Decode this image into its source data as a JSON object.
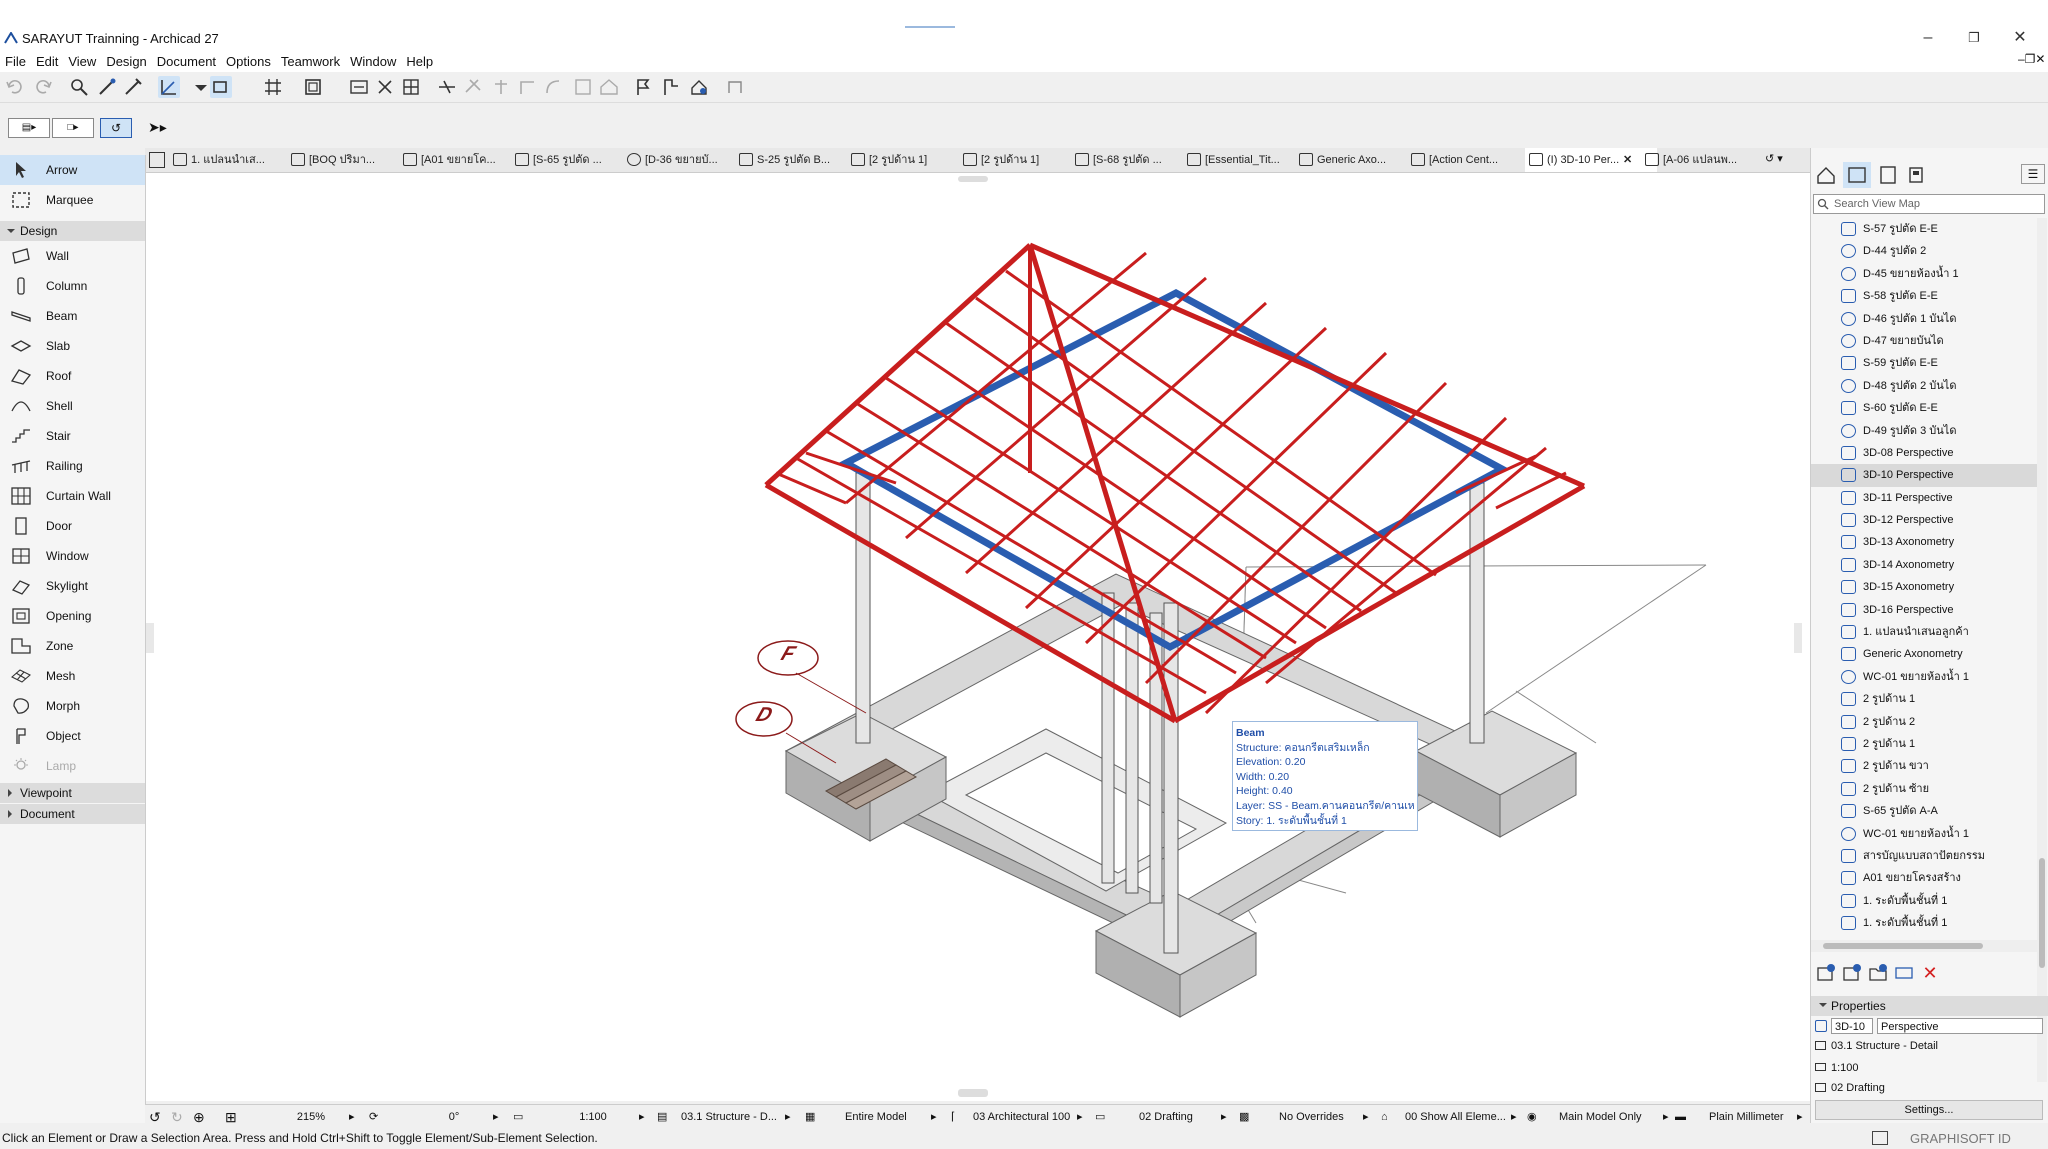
{
  "app": {
    "title": "SARAYUT Trainning - Archicad 27"
  },
  "menu": [
    "File",
    "Edit",
    "View",
    "Design",
    "Document",
    "Options",
    "Teamwork",
    "Window",
    "Help"
  ],
  "toolbox": {
    "active_tool": "Arrow",
    "select_tools": [
      "Arrow",
      "Marquee"
    ],
    "design_header": "Design",
    "design_tools": [
      "Wall",
      "Column",
      "Beam",
      "Slab",
      "Roof",
      "Shell",
      "Stair",
      "Railing",
      "Curtain Wall",
      "Door",
      "Window",
      "Skylight",
      "Opening",
      "Zone",
      "Mesh",
      "Morph",
      "Object",
      "Lamp"
    ],
    "viewpoint_header": "Viewpoint",
    "document_header": "Document"
  },
  "tabs": [
    "1. แปลนนำเส...",
    "[BOQ ปริมา...",
    "[A01 ขยายโค...",
    "[S-65 รูปตัด ...",
    "[D-36 ขยายบั...",
    "S-25 รูปตัด B...",
    "[2 รูปด้าน 1]",
    "[2 รูปด้าน 1]",
    "[S-68 รูปตัด ...",
    "[Essential_Tit...",
    "Generic Axo...",
    "[Action Cent...",
    "(I) 3D-10 Per...",
    "[A-06 แปลนพ..."
  ],
  "viewmap": {
    "search_placeholder": "Search View Map",
    "items": [
      "S-57 รูปตัด E-E",
      "D-44 รูปตัด 2",
      "D-45 ขยายห้องน้ำ 1",
      "S-58 รูปตัด E-E",
      "D-46 รูปตัด 1 บันได",
      "D-47 ขยายบันได",
      "S-59 รูปตัด E-E",
      "D-48 รูปตัด 2 บันได",
      "S-60 รูปตัด E-E",
      "D-49 รูปตัด 3 บันได",
      "3D-08 Perspective",
      "3D-10 Perspective",
      "3D-11 Perspective",
      "3D-12 Perspective",
      "3D-13 Axonometry",
      "3D-14 Axonometry",
      "3D-15 Axonometry",
      "3D-16 Perspective",
      "1. แปลนนำเสนอลูกค้า",
      "Generic Axonometry",
      "WC-01 ขยายห้องน้ำ 1",
      "2 รูปด้าน 1",
      "2 รูปด้าน 2",
      "2 รูปด้าน 1",
      "2 รูปด้าน ขวา",
      "2 รูปด้าน ซ้าย",
      "S-65 รูปตัด A-A",
      "WC-01 ขยายห้องน้ำ 1",
      "สารบัญแบบสถาปัตยกรรม",
      "A01 ขยายโครงสร้าง",
      "1. ระดับพื้นชั้นที่ 1",
      "1. ระดับพื้นชั้นที่ 1"
    ],
    "selected": "3D-10 Perspective"
  },
  "properties": {
    "header": "Properties",
    "id": "3D-10",
    "name": "Perspective",
    "layer_combo": "03.1 Structure - Detail",
    "scale": "1:100",
    "pen_set": "02 Drafting",
    "settings_button": "Settings..."
  },
  "tooltip": {
    "title": "Beam",
    "structure": "Structure: คอนกรีตเสริมเหล็ก",
    "elevation": "Elevation: 0.20",
    "width": "Width: 0.20",
    "height": "Height: 0.40",
    "layer": "Layer: SS - Beam.คานคอนกรีต/คานเหล็ก",
    "story": "Story: 1. ระดับพื้นชั้นที่ 1"
  },
  "grid_labels": {
    "f": "F",
    "d": "D"
  },
  "statusbar": {
    "zoom": "215%",
    "angle": "0°",
    "scale": "1:100",
    "layer_combo": "03.1 Structure - D...",
    "model": "Entire Model",
    "dimension": "03 Architectural 100",
    "pen_set": "02 Drafting",
    "overrides": "No Overrides",
    "renovation": "00 Show All Eleme...",
    "model_only": "Main Model Only",
    "structural": "Plain Millimeter"
  },
  "hint": "Click an Element or Draw a Selection Area. Press and Hold Ctrl+Shift to Toggle Element/Sub-Element Selection.",
  "brand": "GRAPHISOFT ID",
  "colors": {
    "roof": "#c81e1e",
    "selection": "#cfe3f6",
    "accent_blue": "#2a5db0"
  }
}
